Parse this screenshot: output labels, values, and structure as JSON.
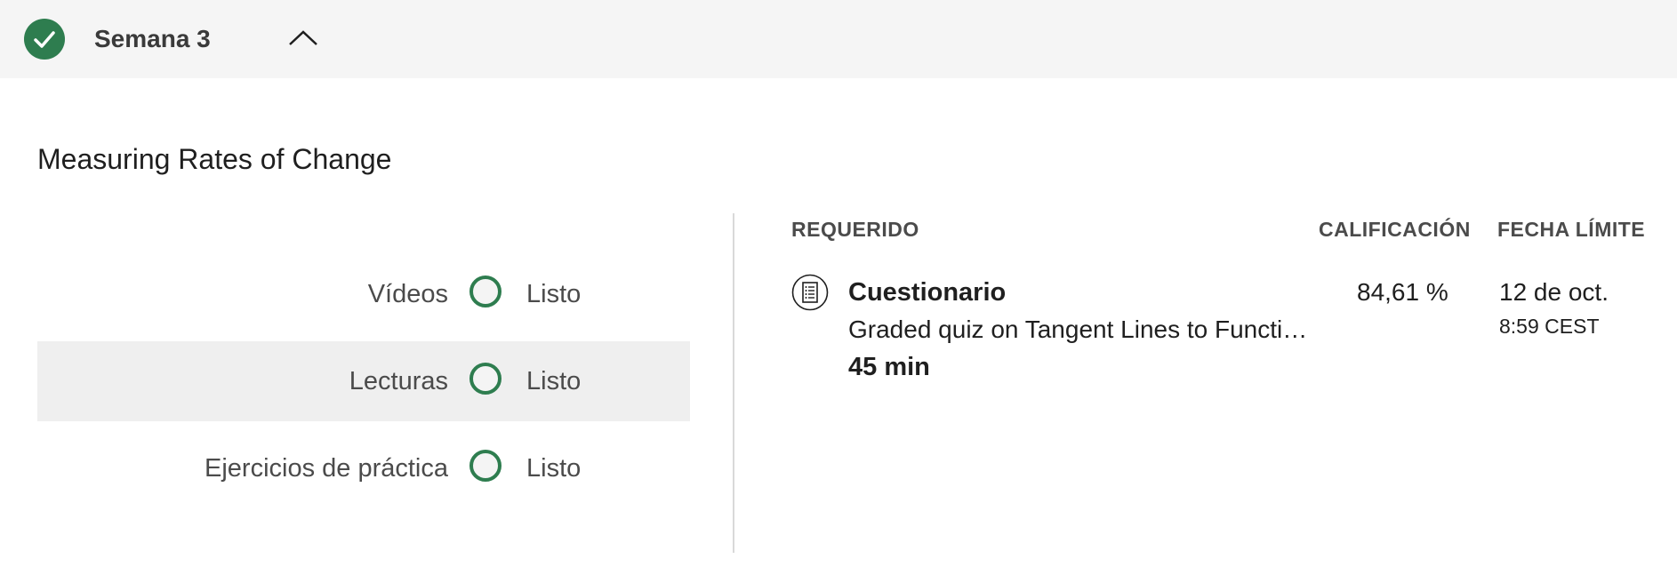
{
  "week": {
    "title": "Semana 3",
    "completed_icon": "check-icon",
    "toggle_icon": "chevron-up-icon"
  },
  "module": {
    "title": "Measuring Rates of Change"
  },
  "progress": [
    {
      "label": "Vídeos",
      "status": "Listo"
    },
    {
      "label": "Lecturas",
      "status": "Listo"
    },
    {
      "label": "Ejercicios de práctica",
      "status": "Listo"
    }
  ],
  "table": {
    "headers": {
      "required": "REQUERIDO",
      "grade": "CALIFICACIÓN",
      "due": "FECHA LÍMITE"
    },
    "items": [
      {
        "icon": "quiz-icon",
        "type": "Cuestionario",
        "name": "Graded quiz on Tangent Lines to Functions",
        "duration": "45 min",
        "grade": "84,61 %",
        "due_date": "12 de oct.",
        "due_time": "8:59 CEST"
      }
    ]
  },
  "colors": {
    "accent_green": "#2e7d4f",
    "header_bg": "#f5f5f5",
    "row_highlight": "#efefef"
  }
}
